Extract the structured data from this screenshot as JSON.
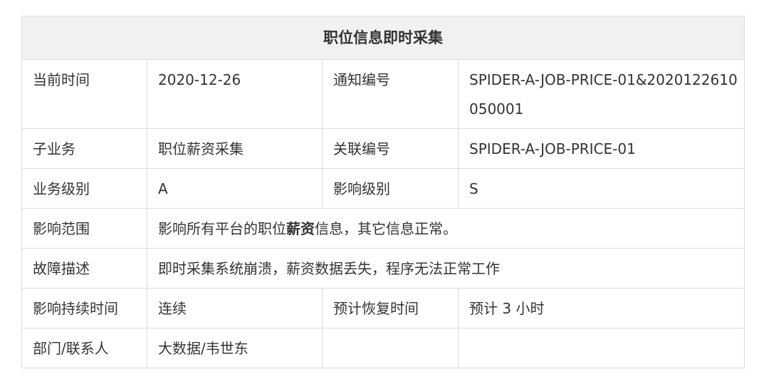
{
  "title": "职位信息即时采集",
  "rows": {
    "r1": {
      "l1": "当前时间",
      "v1": "2020-12-26",
      "l2": "通知编号",
      "v2": "SPIDER-A-JOB-PRICE-01&2020122610050001"
    },
    "r2": {
      "l1": "子业务",
      "v1": "职位薪资采集",
      "l2": "关联编号",
      "v2": "SPIDER-A-JOB-PRICE-01"
    },
    "r3": {
      "l1": "业务级别",
      "v1": "A",
      "l2": "影响级别",
      "v2": "S"
    },
    "r4": {
      "l1": "影响范围",
      "v_pre": "影响所有平台的职位",
      "v_bold": "薪资",
      "v_post": "信息，其它信息正常。"
    },
    "r5": {
      "l1": "故障描述",
      "v1": "即时采集系统崩溃，薪资数据丢失，程序无法正常工作"
    },
    "r6": {
      "l1": "影响持续时间",
      "v1": "连续",
      "l2": "预计恢复时间",
      "v2": "预计 3 小时"
    },
    "r7": {
      "l1": "部门/联系人",
      "v1": "大数据/韦世东",
      "l2": "",
      "v2": ""
    }
  }
}
